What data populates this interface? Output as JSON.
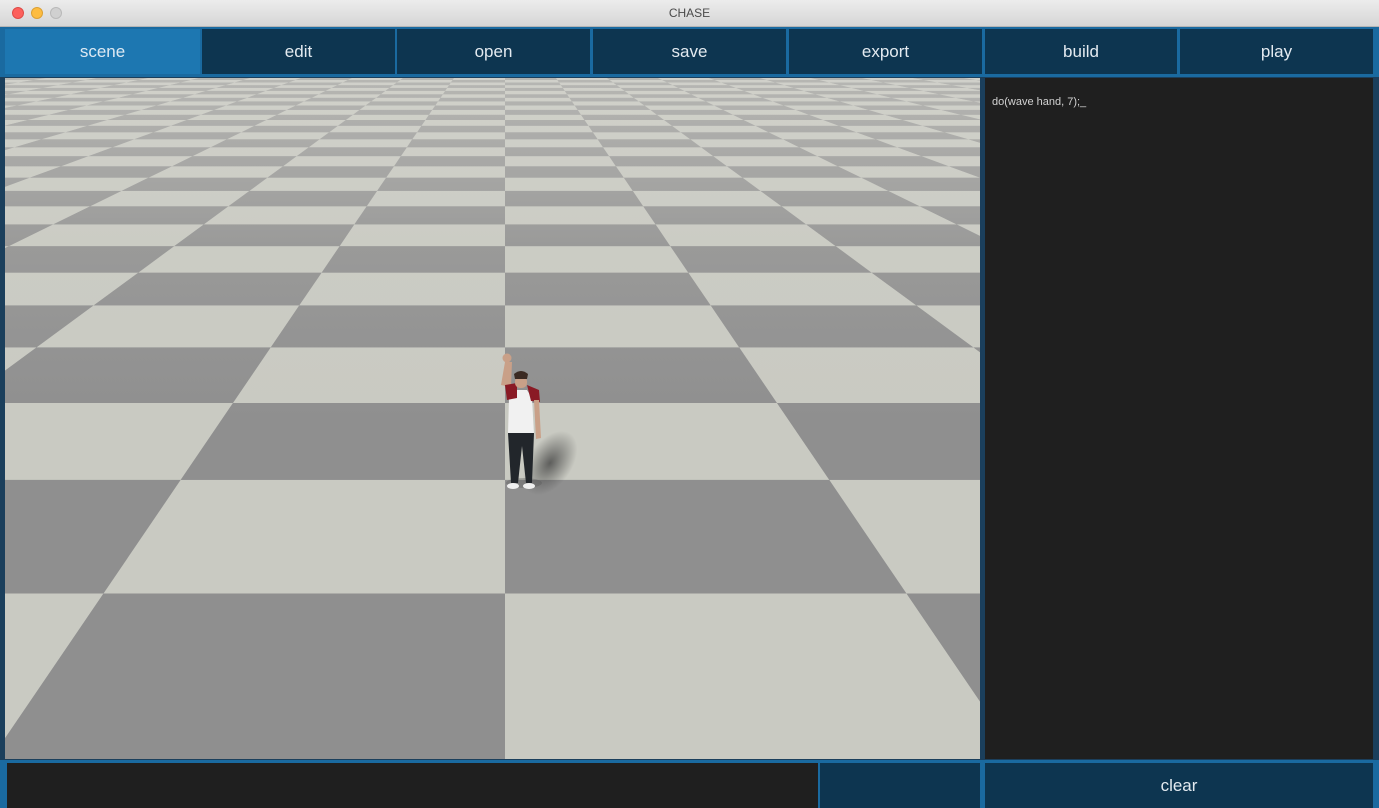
{
  "window": {
    "title": "CHASE"
  },
  "tabs": [
    {
      "label": "scene",
      "active": true
    },
    {
      "label": "edit",
      "active": false
    },
    {
      "label": "open",
      "active": false
    },
    {
      "label": "save",
      "active": false
    },
    {
      "label": "export",
      "active": false
    },
    {
      "label": "build",
      "active": false
    },
    {
      "label": "play",
      "active": false
    }
  ],
  "script": {
    "text": "do(wave hand, 7);_"
  },
  "command": {
    "value": ""
  },
  "bottom": {
    "clear_label": "clear"
  },
  "colors": {
    "tab_bg": "#0d3550",
    "tab_active": "#1d77b1",
    "accent_border": "#1a6aa0",
    "panel_bg": "#1f1f1f",
    "floor_light": "#c9cac2",
    "floor_dark": "#8f8f8f"
  }
}
